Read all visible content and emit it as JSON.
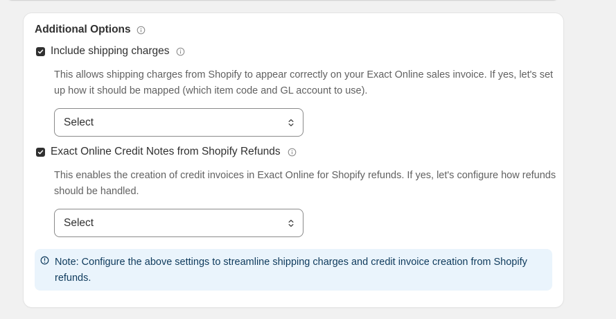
{
  "section": {
    "title": "Additional Options"
  },
  "shipping": {
    "label": "Include shipping charges",
    "checked": true,
    "description": "This allows shipping charges from Shopify to appear correctly on your Exact Online sales invoice. If yes, let's set up how it should be mapped (which item code and GL account to use).",
    "select_value": "Select"
  },
  "credit_notes": {
    "label": "Exact Online Credit Notes from Shopify Refunds",
    "checked": true,
    "description": "This enables the creation of credit invoices in Exact Online for Shopify refunds. If yes, let's configure how refunds should be handled.",
    "select_value": "Select"
  },
  "note": {
    "text": "Note: Configure the above settings to streamline shipping charges and credit invoice creation from Shopify refunds."
  },
  "colors": {
    "note_background": "#eaf4fc",
    "note_text": "#0e3a5c",
    "checkbox": "#303030"
  },
  "icons": {
    "section_info": "info-icon",
    "checkbox_mark": "check-icon",
    "select_chevron": "select-chevron-icon",
    "note_info": "info-icon"
  }
}
